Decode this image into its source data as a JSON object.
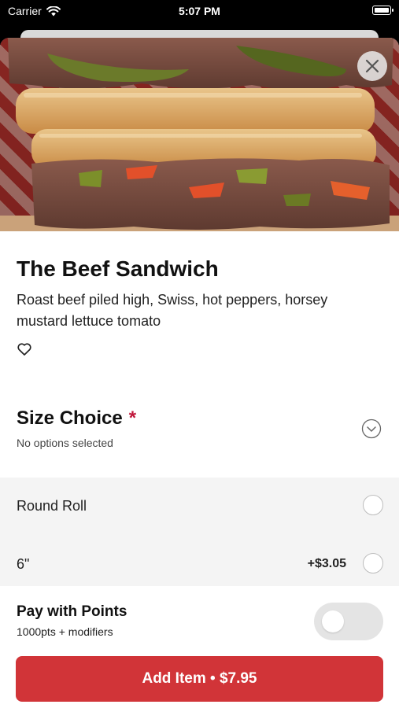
{
  "status_bar": {
    "carrier": "Carrier",
    "time": "5:07 PM",
    "icons": [
      "wifi-icon",
      "battery-icon"
    ]
  },
  "item": {
    "image_alt": "sandwich-photo",
    "name": "The Beef Sandwich",
    "description": "Roast beef piled high, Swiss, hot peppers, horsey mustard lettuce tomato",
    "favorite_icon": "heart-outline-icon"
  },
  "size_choice": {
    "title": "Size Choice",
    "required_marker": "*",
    "subtitle": "No options selected",
    "expand_icon": "chevron-down-circle-icon",
    "options": [
      {
        "label": "Round Roll",
        "price": "",
        "selected": false
      },
      {
        "label": "6\"",
        "price": "+$3.05",
        "selected": false
      }
    ]
  },
  "pay_with_points": {
    "title": "Pay with Points",
    "subtitle": "1000pts + modifiers",
    "enabled": false
  },
  "add_button": {
    "label": "Add Item • $7.95"
  },
  "colors": {
    "accent": "#d13438",
    "required": "#c0163a",
    "options_bg": "#f4f4f4"
  }
}
